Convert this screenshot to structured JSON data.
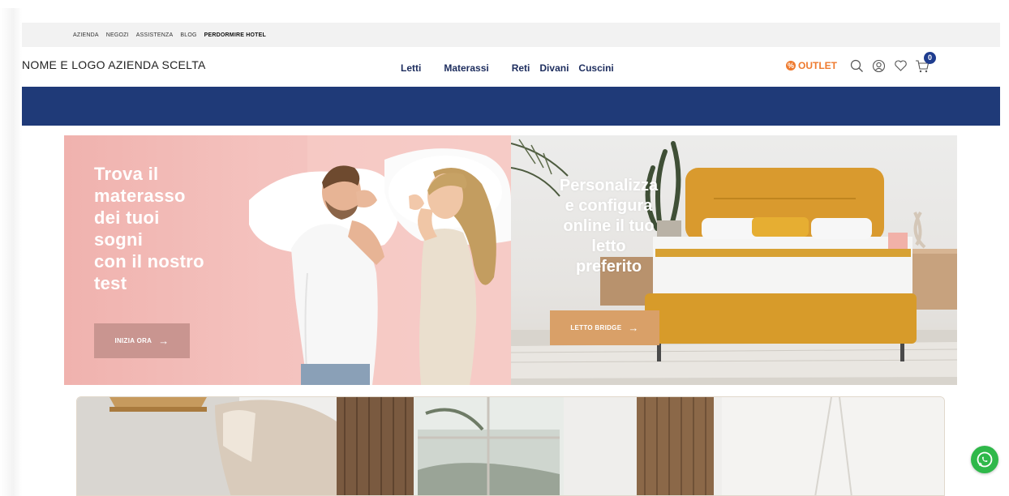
{
  "topbar": {
    "links": [
      "AZIENDA",
      "NEGOZI",
      "ASSISTENZA",
      "BLOG"
    ],
    "highlight": "PERDORMIRE HOTEL"
  },
  "header": {
    "brand": "NOME E LOGO AZIENDA SCELTA",
    "nav": [
      "Letti",
      "Materassi",
      "Reti",
      "Divani",
      "Cuscini"
    ],
    "outlet_label": "OUTLET",
    "cart_count": "0",
    "icons": [
      "search-icon",
      "user-icon",
      "heart-icon",
      "cart-icon"
    ],
    "nav_color": "#1d2d5e",
    "outlet_color": "#ee7a2e"
  },
  "band": {
    "color": "#1f3a78"
  },
  "hero_left": {
    "headline": "Trova il\nmaterasso\ndei tuoi\nsogni\ncon il nostro\ntest",
    "cta": "INIZIA ORA",
    "cta_icon": "arrow-right-icon",
    "bg_color": "#f4c2be"
  },
  "hero_right": {
    "headline": "Personalizza\ne configura\nonline il tuo\nletto\npreferito",
    "cta": "LETTO BRIDGE",
    "cta_icon": "arrow-right-icon",
    "accent": "#d9a068"
  },
  "floating": {
    "whatsapp_icon": "whatsapp-icon"
  }
}
